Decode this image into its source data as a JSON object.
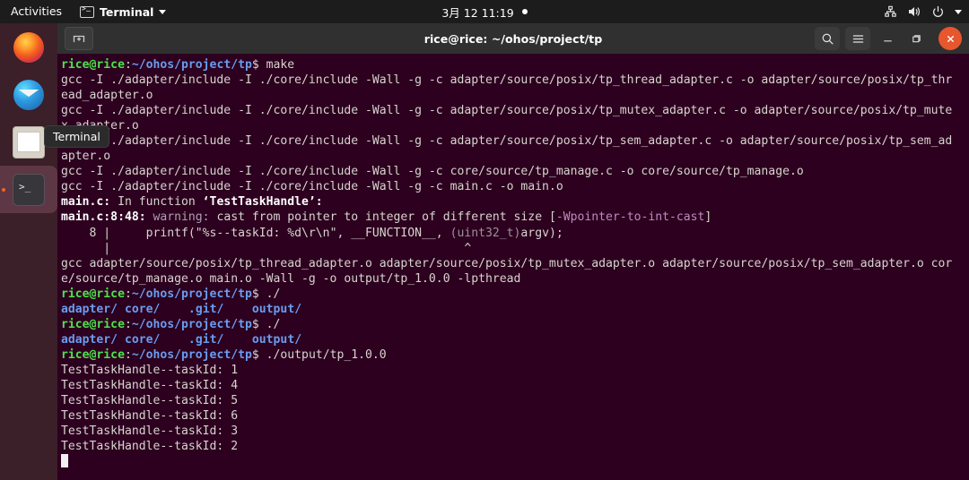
{
  "topbar": {
    "activities": "Activities",
    "app_name": "Terminal",
    "app_icon": "terminal-icon",
    "clock": "3月 12  11:19",
    "indicators": [
      "network-icon",
      "volume-icon",
      "power-icon",
      "chevron-down-icon"
    ]
  },
  "dock": {
    "items": [
      {
        "name": "firefox",
        "label": "Firefox",
        "active": false
      },
      {
        "name": "thunderbird",
        "label": "Thunderbird",
        "active": false
      },
      {
        "name": "files",
        "label": "Files",
        "active": false
      },
      {
        "name": "terminal",
        "label": "Terminal",
        "active": true
      }
    ]
  },
  "tooltip": {
    "text": "Terminal"
  },
  "window": {
    "title": "rice@rice: ~/ohos/project/tp",
    "new_tab_label": "+",
    "buttons": {
      "search": "search-icon",
      "menu": "hamburger-menu-icon",
      "minimize": "minimize-icon",
      "maximize": "maximize-icon",
      "close": "close-icon"
    }
  },
  "terminal": {
    "prompt": {
      "user": "rice@rice",
      "sep": ":",
      "path": "~/ohos/project/tp",
      "dollar": "$ "
    },
    "lines": [
      {
        "type": "prompt",
        "command": "make"
      },
      {
        "type": "plain",
        "text": "gcc -I ./adapter/include -I ./core/include -Wall -g -c adapter/source/posix/tp_thread_adapter.c -o adapter/source/posix/tp_thr"
      },
      {
        "type": "plain",
        "text": "ead_adapter.o"
      },
      {
        "type": "plain",
        "text": "gcc -I ./adapter/include -I ./core/include -Wall -g -c adapter/source/posix/tp_mutex_adapter.c -o adapter/source/posix/tp_mute"
      },
      {
        "type": "plain",
        "text": "x_adapter.o"
      },
      {
        "type": "plain",
        "text": "gcc -I ./adapter/include -I ./core/include -Wall -g -c adapter/source/posix/tp_sem_adapter.c -o adapter/source/posix/tp_sem_ad"
      },
      {
        "type": "plain",
        "text": "apter.o"
      },
      {
        "type": "plain",
        "text": "gcc -I ./adapter/include -I ./core/include -Wall -g -c core/source/tp_manage.c -o core/source/tp_manage.o"
      },
      {
        "type": "plain",
        "text": "gcc -I ./adapter/include -I ./core/include -Wall -g -c main.c -o main.o"
      },
      {
        "type": "diag_func",
        "file": "main.c:",
        "rest": " In function ",
        "func": "‘TestTaskHandle’:"
      },
      {
        "type": "diag_warn",
        "loc": "main.c:8:48:",
        "kw": " warning: ",
        "msg": "cast from pointer to integer of different size ",
        "flag": "[-Wpointer-to-int-cast]"
      },
      {
        "type": "code",
        "num": "    8 |",
        "code": "     printf(\"%s--taskId: %d\\r\\n\", __FUNCTION__, ",
        "cast": "(uint32_t)",
        "tail": "argv);"
      },
      {
        "type": "caret",
        "bar": "      |",
        "caret": "                                                  ^"
      },
      {
        "type": "plain",
        "text": "gcc adapter/source/posix/tp_thread_adapter.o adapter/source/posix/tp_mutex_adapter.o adapter/source/posix/tp_sem_adapter.o cor"
      },
      {
        "type": "plain",
        "text": "e/source/tp_manage.o main.o -Wall -g -o output/tp_1.0.0 -lpthread"
      },
      {
        "type": "prompt",
        "command": "./"
      },
      {
        "type": "completion",
        "items": [
          "adapter/",
          "core/",
          "   .git/",
          "   output/"
        ]
      },
      {
        "type": "prompt",
        "command": "./"
      },
      {
        "type": "completion",
        "items": [
          "adapter/",
          "core/",
          "   .git/",
          "   output/"
        ]
      },
      {
        "type": "prompt",
        "command": "./output/tp_1.0.0"
      },
      {
        "type": "plain",
        "text": "TestTaskHandle--taskId: 1"
      },
      {
        "type": "plain",
        "text": "TestTaskHandle--taskId: 4"
      },
      {
        "type": "plain",
        "text": "TestTaskHandle--taskId: 5"
      },
      {
        "type": "plain",
        "text": "TestTaskHandle--taskId: 6"
      },
      {
        "type": "plain",
        "text": "TestTaskHandle--taskId: 3"
      },
      {
        "type": "plain",
        "text": "TestTaskHandle--taskId: 2"
      },
      {
        "type": "cursor",
        "text": ""
      }
    ]
  },
  "colors": {
    "terminal_bg": "#2c001e",
    "dock_bg": "#3b1f29",
    "titlebar_bg": "#303030",
    "topbar_bg": "#1c1c1c",
    "prompt_user": "#4ee24e",
    "prompt_path": "#6a9cf0",
    "close_button": "#e6572e",
    "accent_orange": "#e8672b"
  }
}
